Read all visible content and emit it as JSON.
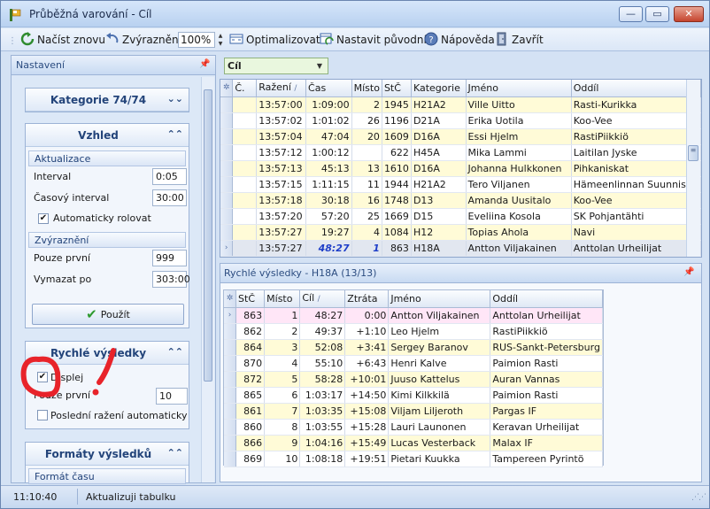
{
  "window": {
    "title": "Průběžná varování - Cíl",
    "buttons": {
      "minimize": "—",
      "maximize": "▭",
      "close": "✕"
    }
  },
  "toolbar": {
    "reload": "Načíst znovu",
    "highlight": "Zvýraznění",
    "zoom": "100%",
    "optimize": "Optimalizovat",
    "reset": "Nastavit původní",
    "help": "Nápověda",
    "close": "Zavřít"
  },
  "settings": {
    "header": "Nastavení",
    "category_group": {
      "title": "Kategorie  74/74"
    },
    "look_group": {
      "title": "Vzhled",
      "refresh_section": "Aktualizace",
      "interval_label": "Interval",
      "interval_value": "0:05",
      "time_interval_label": "Časový interval",
      "time_interval_value": "30:00",
      "auto_scroll_label": "Automaticky rolovat",
      "highlight_section": "Zvýraznění",
      "only_first_label": "Pouze první",
      "only_first_value": "999",
      "delete_after_label": "Vymazat po",
      "delete_after_value": "303:00",
      "apply_label": "Použít"
    },
    "quick_group": {
      "title": "Rychlé výsledky",
      "display_label": "Displej",
      "only_first_label": "Pouze první",
      "only_first_value": "10",
      "last_punch_label": "Poslední ražení automaticky"
    },
    "formats_group": {
      "title": "Formáty výsledků",
      "time_format_label": "Formát času"
    }
  },
  "filter": {
    "value": "Cíl"
  },
  "punch_grid": {
    "columns": [
      "Č.",
      "Ražení",
      "Čas",
      "Místo",
      "StČ",
      "Kategorie",
      "Jméno",
      "Oddíl"
    ],
    "rows": [
      {
        "cislo": "",
        "razeni": "13:57:00",
        "cas": "1:09:00",
        "misto": "2",
        "stc": "1945",
        "kat": "H21A2",
        "jmeno": "Ville Uitto",
        "oddil": "Rasti-Kurikka",
        "style": "yel"
      },
      {
        "cislo": "",
        "razeni": "13:57:02",
        "cas": "1:01:02",
        "misto": "26",
        "stc": "1196",
        "kat": "D21A",
        "jmeno": "Erika Uotila",
        "oddil": "Koo-Vee",
        "style": "wht"
      },
      {
        "cislo": "",
        "razeni": "13:57:04",
        "cas": "47:04",
        "misto": "20",
        "stc": "1609",
        "kat": "D16A",
        "jmeno": "Essi Hjelm",
        "oddil": "RastiPiikkiö",
        "style": "yel"
      },
      {
        "cislo": "",
        "razeni": "13:57:12",
        "cas": "1:00:12",
        "misto": "",
        "stc": "622",
        "kat": "H45A",
        "jmeno": "Mika Lammi",
        "oddil": "Laitilan Jyske",
        "style": "wht"
      },
      {
        "cislo": "",
        "razeni": "13:57:13",
        "cas": "45:13",
        "misto": "13",
        "stc": "1610",
        "kat": "D16A",
        "jmeno": "Johanna Hulkkonen",
        "oddil": "Pihkaniskat",
        "style": "yel"
      },
      {
        "cislo": "",
        "razeni": "13:57:15",
        "cas": "1:11:15",
        "misto": "11",
        "stc": "1944",
        "kat": "H21A2",
        "jmeno": "Tero Viljanen",
        "oddil": "Hämeenlinnan Suunnistaj",
        "style": "wht"
      },
      {
        "cislo": "",
        "razeni": "13:57:18",
        "cas": "30:18",
        "misto": "16",
        "stc": "1748",
        "kat": "D13",
        "jmeno": "Amanda Uusitalo",
        "oddil": "Koo-Vee",
        "style": "yel"
      },
      {
        "cislo": "",
        "razeni": "13:57:20",
        "cas": "57:20",
        "misto": "25",
        "stc": "1669",
        "kat": "D15",
        "jmeno": "Eveliina Kosola",
        "oddil": "SK Pohjantähti",
        "style": "wht"
      },
      {
        "cislo": "",
        "razeni": "13:57:27",
        "cas": "19:27",
        "misto": "4",
        "stc": "1084",
        "kat": "H12",
        "jmeno": "Topias Ahola",
        "oddil": "Navi",
        "style": "yel"
      },
      {
        "cislo": "",
        "razeni": "13:57:27",
        "cas": "48:27",
        "misto": "1",
        "stc": "863",
        "kat": "H18A",
        "jmeno": "Antton Viljakainen",
        "oddil": "Anttolan Urheilijat",
        "style": "sel"
      }
    ]
  },
  "quick_results": {
    "header": "Rychlé výsledky - H18A (13/13)",
    "columns": [
      "StČ",
      "Místo",
      "Cíl",
      "Ztráta",
      "Jméno",
      "Oddíl"
    ],
    "rows": [
      {
        "stc": "863",
        "misto": "1",
        "cil": "48:27",
        "ztrata": "0:00",
        "jmeno": "Antton Viljakainen",
        "oddil": "Anttolan Urheilijat",
        "style": "pink"
      },
      {
        "stc": "862",
        "misto": "2",
        "cil": "49:37",
        "ztrata": "+1:10",
        "jmeno": "Leo Hjelm",
        "oddil": "RastiPiikkiö",
        "style": "wht"
      },
      {
        "stc": "864",
        "misto": "3",
        "cil": "52:08",
        "ztrata": "+3:41",
        "jmeno": "Sergey Baranov",
        "oddil": "RUS-Sankt-Petersburg",
        "style": "yel"
      },
      {
        "stc": "870",
        "misto": "4",
        "cil": "55:10",
        "ztrata": "+6:43",
        "jmeno": "Henri Kalve",
        "oddil": "Paimion Rasti",
        "style": "wht"
      },
      {
        "stc": "872",
        "misto": "5",
        "cil": "58:28",
        "ztrata": "+10:01",
        "jmeno": "Juuso Kattelus",
        "oddil": "Auran Vannas",
        "style": "yel"
      },
      {
        "stc": "865",
        "misto": "6",
        "cil": "1:03:17",
        "ztrata": "+14:50",
        "jmeno": "Kimi Kilkkilä",
        "oddil": "Paimion Rasti",
        "style": "wht"
      },
      {
        "stc": "861",
        "misto": "7",
        "cil": "1:03:35",
        "ztrata": "+15:08",
        "jmeno": "Viljam Liljeroth",
        "oddil": "Pargas IF",
        "style": "yel"
      },
      {
        "stc": "860",
        "misto": "8",
        "cil": "1:03:55",
        "ztrata": "+15:28",
        "jmeno": "Lauri Launonen",
        "oddil": "Keravan Urheilijat",
        "style": "wht"
      },
      {
        "stc": "866",
        "misto": "9",
        "cil": "1:04:16",
        "ztrata": "+15:49",
        "jmeno": "Lucas Vesterback",
        "oddil": "Malax IF",
        "style": "yel"
      },
      {
        "stc": "869",
        "misto": "10",
        "cil": "1:08:18",
        "ztrata": "+19:51",
        "jmeno": "Pietari Kuukka",
        "oddil": "Tampereen Pyrintö",
        "style": "wht"
      }
    ]
  },
  "status": {
    "time": "11:10:40",
    "message": "Aktualizuji tabulku"
  },
  "colors": {
    "accent": "#23447a",
    "highlight_yellow": "#fffbd7",
    "highlight_pink": "#ffe6f7",
    "annotation_red": "#e8232a"
  }
}
